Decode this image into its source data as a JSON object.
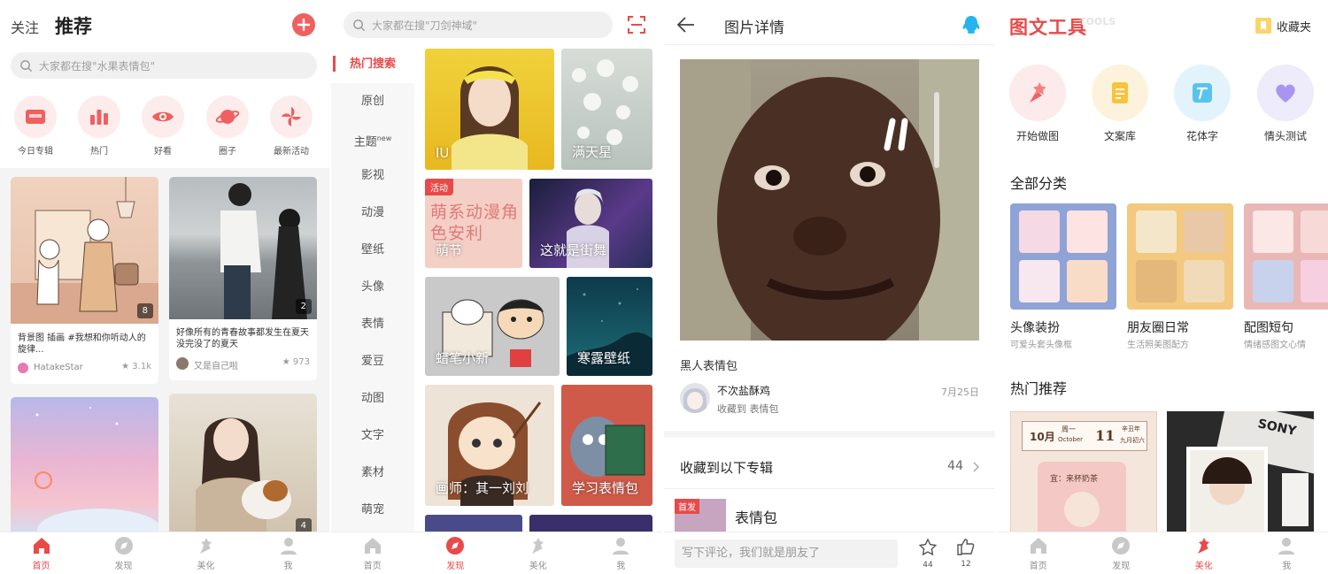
{
  "colors": {
    "accent": "#e84a4a",
    "bg": "#f4f4f4"
  },
  "tabbar": {
    "items": [
      "首页",
      "发现",
      "美化",
      "我"
    ]
  },
  "home": {
    "tab_follow": "关注",
    "tab_recommend": "推荐",
    "search_placeholder": "大家都在搜\"水果表情包\"",
    "quick": [
      {
        "label": "今日专辑",
        "icon": "album-icon"
      },
      {
        "label": "热门",
        "icon": "chart-icon"
      },
      {
        "label": "好看",
        "icon": "eye-icon"
      },
      {
        "label": "圈子",
        "icon": "planet-icon"
      },
      {
        "label": "最新活动",
        "icon": "pinwheel-icon"
      }
    ],
    "cards": [
      {
        "title": "背景图 插画 #我想和你听动人的旋律...",
        "user": "HatakeStar",
        "count": "3.1k",
        "badge": "8"
      },
      {
        "title": "好像所有的青春故事都发生在夏天 没完没了的夏天",
        "user": "又是自己啦",
        "count": "973",
        "badge": "2"
      },
      {
        "badge": ""
      },
      {
        "badge": "4"
      }
    ]
  },
  "discover": {
    "search_placeholder": "大家都在搜\"刀剑神域\"",
    "categories": [
      "热门搜索",
      "原创",
      "主题",
      "影视",
      "动漫",
      "壁纸",
      "头像",
      "表情",
      "爱豆",
      "动图",
      "文字",
      "素材",
      "萌宠"
    ],
    "new_badge": "new",
    "tiles": [
      "IU",
      "满天星",
      "萌节",
      "这就是街舞",
      "蜡笔小新",
      "寒露壁纸",
      "画师：其一刘刘",
      "学习表情包"
    ],
    "activity_tag": "活动",
    "moe_art": "萌系动漫角色安利"
  },
  "detail": {
    "title": "图片详情",
    "caption": "黑人表情包",
    "user": "不次盐酥鸡",
    "action": "收藏到 表情包",
    "date": "7月25日",
    "collect_label": "收藏到以下专辑",
    "collect_count": "44",
    "album_tag": "首发",
    "album_name": "表情包",
    "comment_placeholder": "写下评论，我们就是朋友了",
    "star_count": "44",
    "like_count": "12"
  },
  "tools": {
    "logo": "图文工具",
    "logo_sub": "TOOLS",
    "favorites": "收藏夹",
    "tools": [
      {
        "label": "开始做图",
        "icon": "paint-icon"
      },
      {
        "label": "文案库",
        "icon": "document-icon"
      },
      {
        "label": "花体字",
        "icon": "font-icon"
      },
      {
        "label": "情头测试",
        "icon": "heart-icon"
      }
    ],
    "all_categories": "全部分类",
    "categories": [
      {
        "name": "头像装扮",
        "sub": "可爱头套头像框"
      },
      {
        "name": "朋友圈日常",
        "sub": "生活照美图配方"
      },
      {
        "name": "配图短句",
        "sub": "情绪感图文心情"
      }
    ],
    "hot": "热门推荐",
    "cal": {
      "month": "10月",
      "week": "周一",
      "week_en": "October",
      "day": "11",
      "lunar1": "辛丑年",
      "lunar2": "九月初六",
      "todo": "宜：来杯奶茶"
    },
    "sony": "SONY"
  }
}
